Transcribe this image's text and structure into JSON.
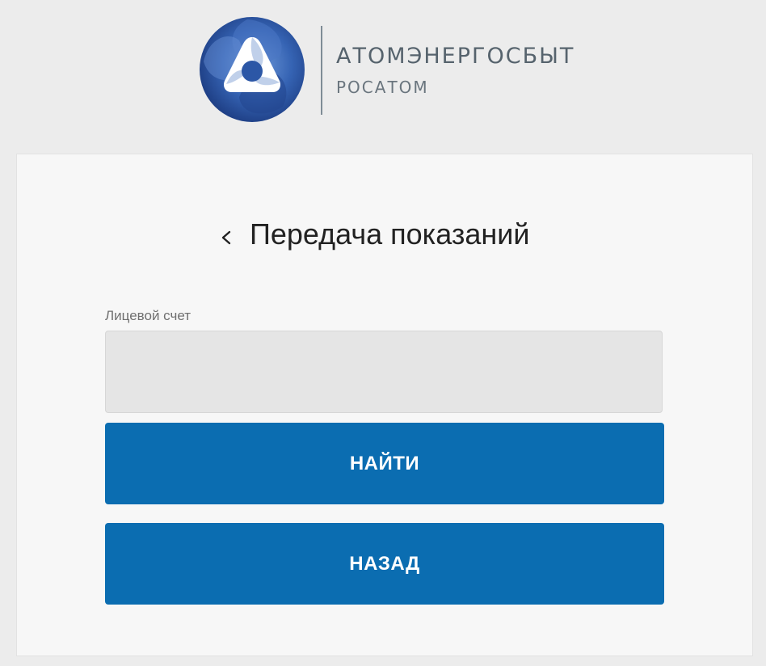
{
  "header": {
    "brand_name": "АТОМЭНЕРГОСБЫТ",
    "brand_sub": "РОСАТОМ",
    "logo_icon": "rosatom-emblem-icon"
  },
  "form": {
    "back_icon": "chevron-left-icon",
    "title": "Передача показаний",
    "account_label": "Лицевой счет",
    "account_value": "",
    "find_label": "НАЙТИ",
    "back_label": "НАЗАД"
  },
  "colors": {
    "page_background": "#ececec",
    "card_background": "#f7f7f7",
    "button_primary": "#0b6db1",
    "input_background": "#e5e5e5",
    "brand_text": "#56636d",
    "emblem_dark": "#1d3f83",
    "emblem_light": "#5b89d0"
  }
}
